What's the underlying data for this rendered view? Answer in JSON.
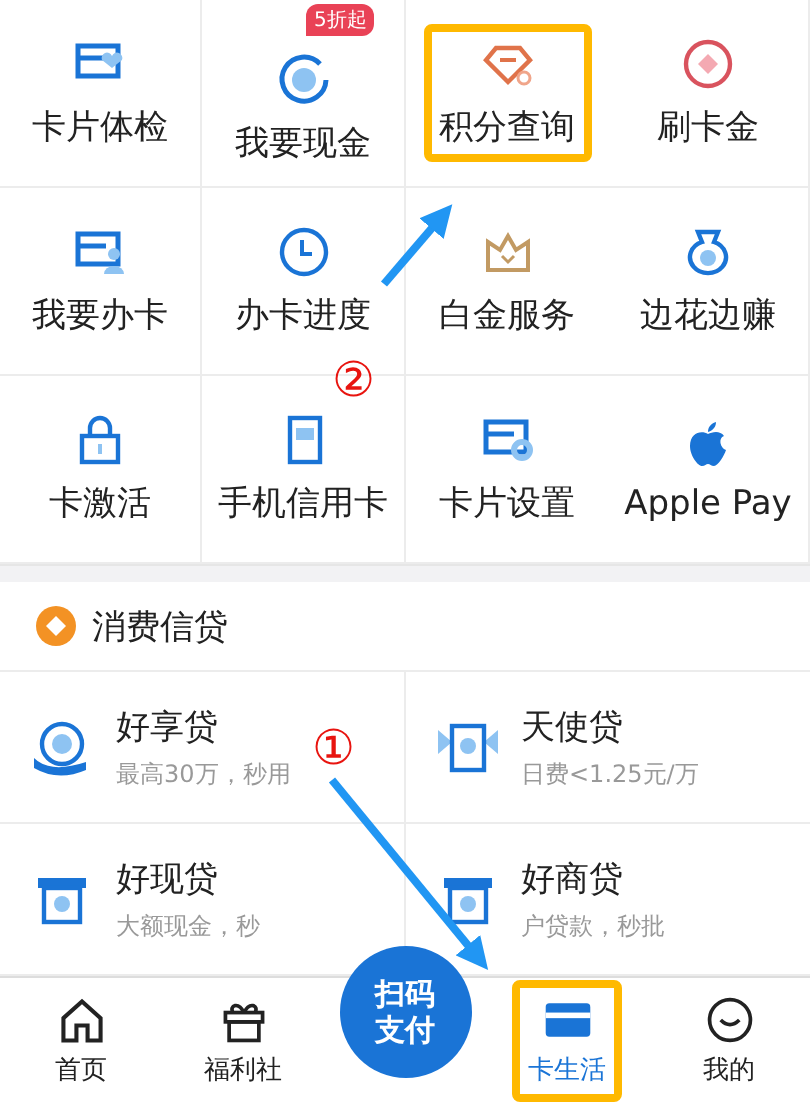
{
  "grid": [
    {
      "label": "卡片体检",
      "highlighted": false
    },
    {
      "label": "我要现金",
      "badge": "5折起",
      "highlighted": false
    },
    {
      "label": "积分查询",
      "highlighted": true
    },
    {
      "label": "刷卡金",
      "highlighted": false
    },
    {
      "label": "我要办卡",
      "highlighted": false
    },
    {
      "label": "办卡进度",
      "highlighted": false
    },
    {
      "label": "白金服务",
      "highlighted": false
    },
    {
      "label": "边花边赚",
      "highlighted": false
    },
    {
      "label": "卡激活",
      "highlighted": false
    },
    {
      "label": "手机信用卡",
      "highlighted": false
    },
    {
      "label": "卡片设置",
      "highlighted": false
    },
    {
      "label": "Apple Pay",
      "highlighted": false
    }
  ],
  "section": {
    "title": "消费信贷"
  },
  "loans": [
    {
      "name": "好享贷",
      "subtitle": "最高30万，秒用"
    },
    {
      "name": "天使贷",
      "subtitle": "日费<1.25元/万"
    },
    {
      "name": "好现贷",
      "subtitle": "大额现金，秒"
    },
    {
      "name": "好商贷",
      "subtitle": "户贷款，秒批"
    }
  ],
  "tab_bar": {
    "items": [
      {
        "label": "首页",
        "selected": false,
        "highlighted": false
      },
      {
        "label": "福利社",
        "selected": false,
        "highlighted": false
      },
      {
        "label": "卡生活",
        "selected": true,
        "highlighted": true
      },
      {
        "label": "我的",
        "selected": false,
        "highlighted": false
      }
    ],
    "scan_button": {
      "label": "扫码支付"
    }
  },
  "annotations": [
    {
      "number": "②"
    },
    {
      "number": "①"
    }
  ]
}
